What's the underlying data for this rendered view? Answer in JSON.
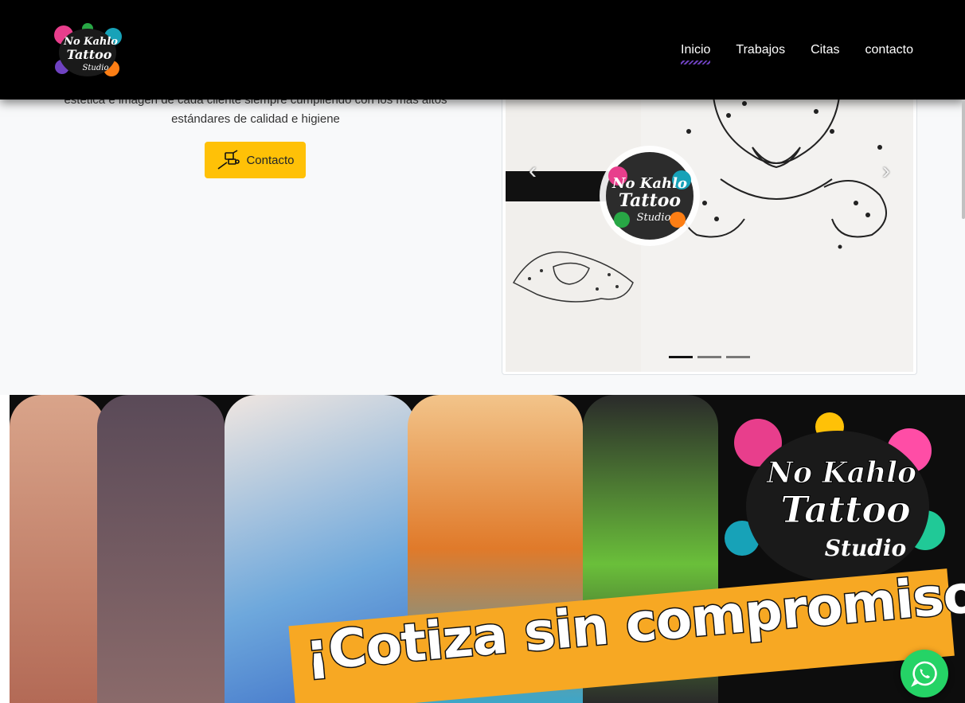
{
  "brand": {
    "logo_text_line1": "No Kahlo",
    "logo_text_line2": "Tattoo",
    "logo_text_line3": "Studio"
  },
  "nav": {
    "items": [
      {
        "label": "Inicio",
        "active": true
      },
      {
        "label": "Trabajos",
        "active": false
      },
      {
        "label": "Citas",
        "active": false
      },
      {
        "label": "contacto",
        "active": false
      }
    ]
  },
  "hero": {
    "text_line1": "estética e imagen de cada cliente siempre cumpliendo con los más altos",
    "text_line2": "estándares de calidad e higiene",
    "contact_button": "Contacto",
    "contact_icon": "tattoo-machine-icon"
  },
  "carousel": {
    "slide_count": 3,
    "active_index": 0,
    "prev_icon": "chevron-left-icon",
    "next_icon": "chevron-right-icon"
  },
  "banner": {
    "headline": "¡Cotiza sin compromiso!"
  },
  "whatsapp": {
    "icon": "whatsapp-icon",
    "color": "#25d366"
  },
  "colors": {
    "navbar": "#000000",
    "accent": "#ffc107",
    "active_underline": "#6f42c1",
    "banner_band": "#f7a823"
  }
}
